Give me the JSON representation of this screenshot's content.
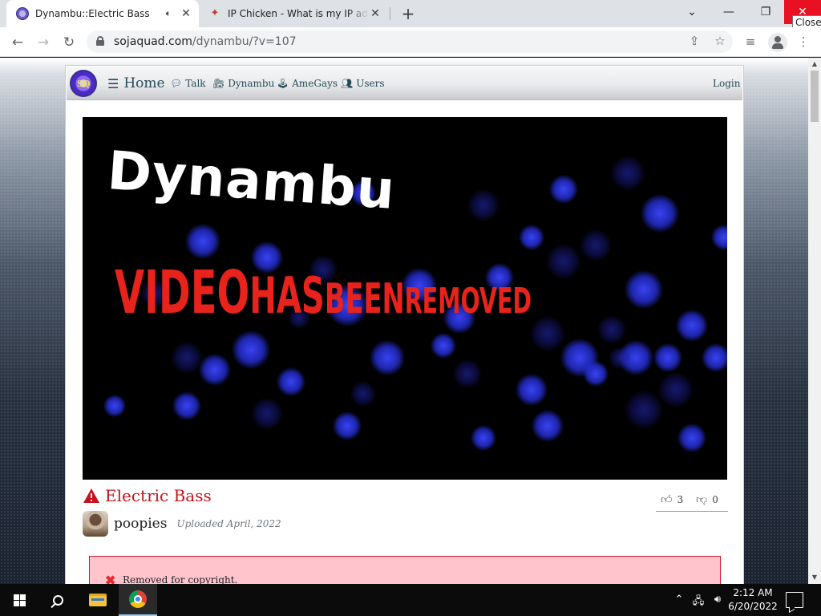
{
  "browser": {
    "tabs": [
      {
        "title": "Dynambu::Electric Bass",
        "active": true,
        "audio": true
      },
      {
        "title": "IP Chicken - What is my IP address",
        "active": false
      }
    ],
    "new_tab_label": "+",
    "window_controls": {
      "minimize": "—",
      "restore": "❐",
      "close": "✕"
    },
    "close_tooltip": "Close",
    "url_host": "sojaquad.com",
    "url_path": "/dynambu/?v=107"
  },
  "site": {
    "logo_text": "SQ",
    "nav": {
      "home": "Home",
      "talk": "Talk",
      "dynambu": "Dynambu",
      "amegays": "AmeGays",
      "users": "Users",
      "login": "Login"
    }
  },
  "video": {
    "brand_text": "Dynambu",
    "removed_words": [
      "VIDEO",
      "HAS",
      "BEEN",
      "REMOVED"
    ]
  },
  "post": {
    "title": "Electric Bass",
    "likes": "3",
    "dislikes": "0",
    "username": "poopies",
    "uploaded": "Uploaded April, 2022",
    "notice": "Removed for copyright."
  },
  "taskbar": {
    "time": "2:12 AM",
    "date": "6/20/2022"
  },
  "colors": {
    "accent_red": "#c0161c",
    "notice_bg": "#ffc4cc",
    "nav_text": "#264a58",
    "close_red": "#e81123"
  }
}
